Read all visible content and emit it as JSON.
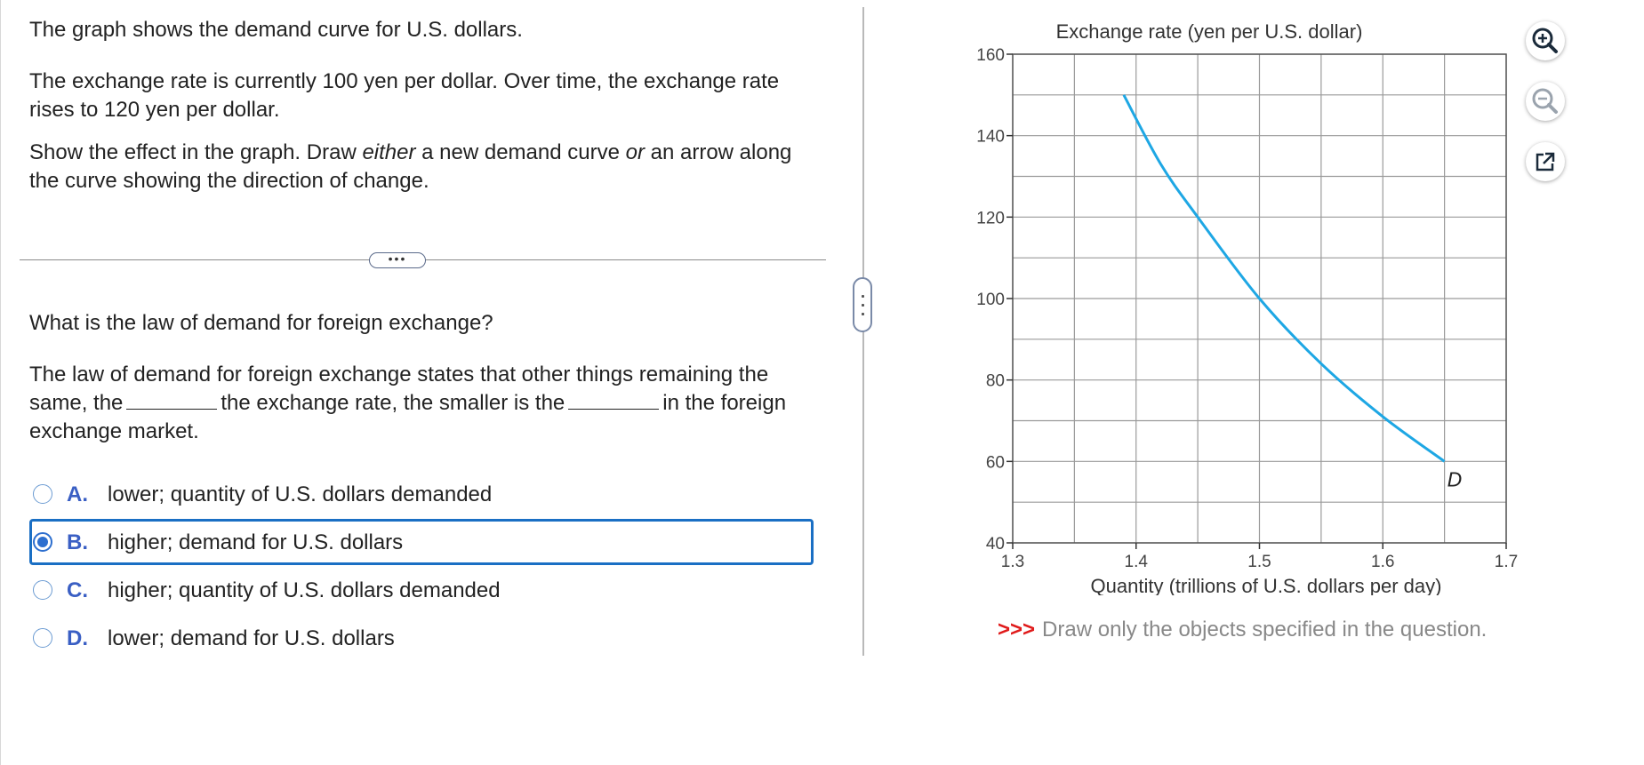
{
  "intro": {
    "line1": "The graph shows the demand curve for U.S. dollars.",
    "line2": "The exchange rate is currently 100 yen per dollar. Over time, the exchange rate rises to 120 yen per dollar.",
    "line3_pre": "Show the effect in the graph. Draw ",
    "line3_em1": "either",
    "line3_mid": " a new demand curve ",
    "line3_em2": "or",
    "line3_post": " an arrow along the curve showing the direction of change."
  },
  "more_button": "•••",
  "question": "What is the law of demand for foreign exchange?",
  "law": {
    "part1": "The law of demand for foreign exchange states that other things remaining the same, the",
    "part2": "the exchange rate, the smaller is the",
    "part3": "in the foreign exchange market."
  },
  "options": [
    {
      "letter": "A.",
      "text": "lower; quantity of U.S. dollars demanded",
      "selected": false
    },
    {
      "letter": "B.",
      "text": "higher; demand for U.S. dollars",
      "selected": true
    },
    {
      "letter": "C.",
      "text": "higher; quantity of U.S. dollars demanded",
      "selected": false
    },
    {
      "letter": "D.",
      "text": "lower; demand for U.S. dollars",
      "selected": false
    }
  ],
  "draw_note": {
    "arrows": ">>>",
    "text": "Draw only the objects specified in the question."
  },
  "tools": [
    "zoom-in-icon",
    "zoom-out-icon",
    "popout-icon"
  ],
  "chart_data": {
    "type": "line",
    "title": "Exchange rate (yen per U.S. dollar)",
    "xlabel": "Quantity (trillions of U.S. dollars per day)",
    "ylabel": "Exchange rate (yen per U.S. dollar)",
    "xlim": [
      1.3,
      1.7
    ],
    "ylim": [
      40,
      160
    ],
    "x_ticks": [
      "1.3",
      "1.4",
      "1.5",
      "1.6",
      "1.7"
    ],
    "y_ticks": [
      "40",
      "60",
      "80",
      "100",
      "120",
      "140",
      "160"
    ],
    "grid": true,
    "series": [
      {
        "name": "D",
        "color": "#1ea7e4",
        "points": [
          [
            1.39,
            150
          ],
          [
            1.42,
            133
          ],
          [
            1.45,
            120
          ],
          [
            1.5,
            100
          ],
          [
            1.55,
            84
          ],
          [
            1.6,
            71
          ],
          [
            1.65,
            60
          ]
        ]
      }
    ]
  }
}
